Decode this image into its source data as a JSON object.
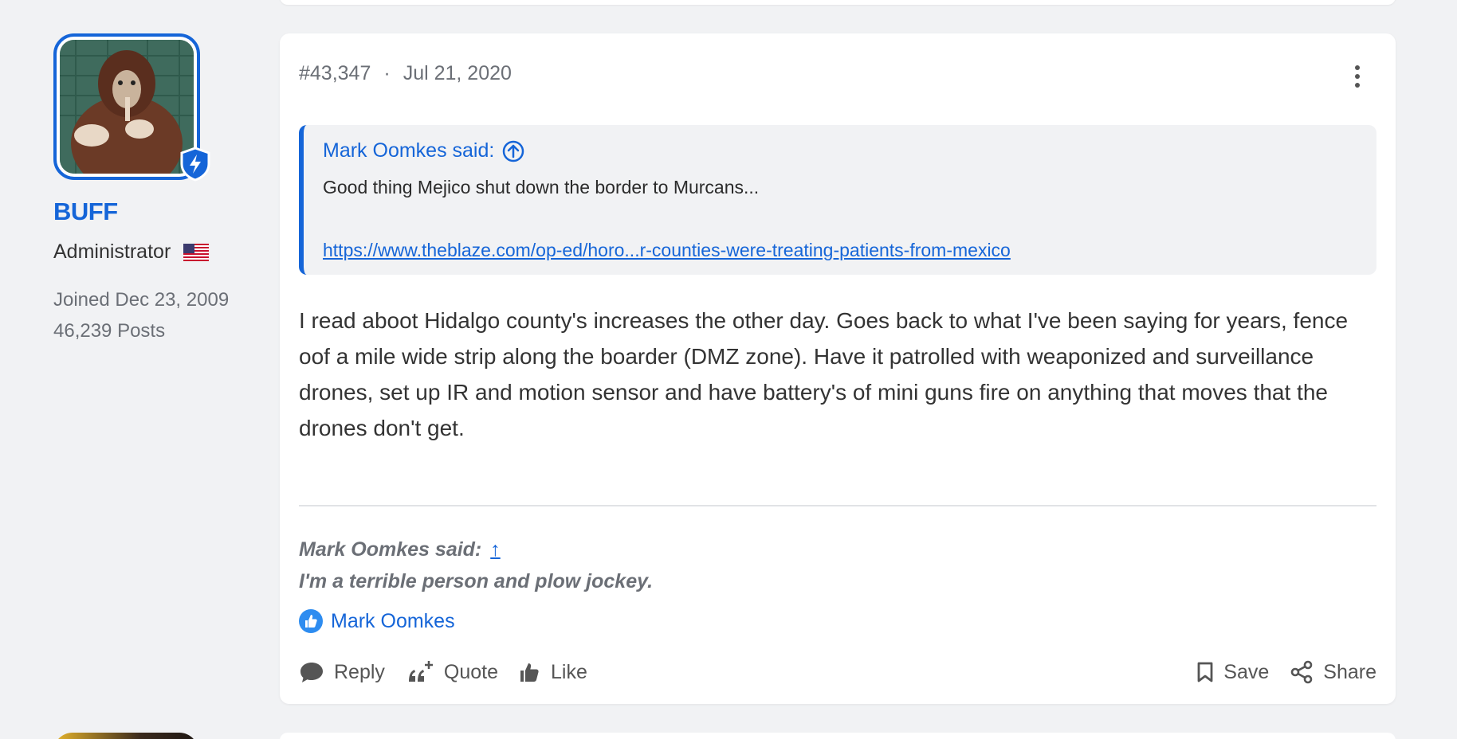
{
  "user": {
    "name": "BUFF",
    "role": "Administrator",
    "joined": "Joined Dec 23, 2009",
    "posts": "46,239 Posts",
    "flag_icon": "us-flag-icon",
    "badge_icon": "lightning-shield-icon"
  },
  "post": {
    "number": "#43,347",
    "separator": "·",
    "date": "Jul 21, 2020",
    "quote": {
      "author": "Mark Oomkes said:",
      "text": "Good thing Mejico shut down the border to Murcans...",
      "link": "https://www.theblaze.com/op-ed/horo...r-counties-were-treating-patients-from-mexico"
    },
    "body": "I read aboot Hidalgo county's increases the other day. Goes back to what I've been saying for years, fence oof a mile wide strip along the boarder (DMZ zone). Have it patrolled with weaponized and surveillance drones, set up IR and motion sensor and have battery's of mini guns fire on anything that moves that the drones don't get.",
    "signature": {
      "author": "Mark Oomkes said:",
      "arrow": "↑",
      "text": "I'm a terrible person and plow jockey."
    },
    "reaction_user": "Mark Oomkes"
  },
  "actions": {
    "reply": "Reply",
    "quote": "Quote",
    "like": "Like",
    "save": "Save",
    "share": "Share"
  },
  "colors": {
    "accent": "#1565d8",
    "background": "#f1f2f4",
    "muted": "#6b6f76"
  }
}
